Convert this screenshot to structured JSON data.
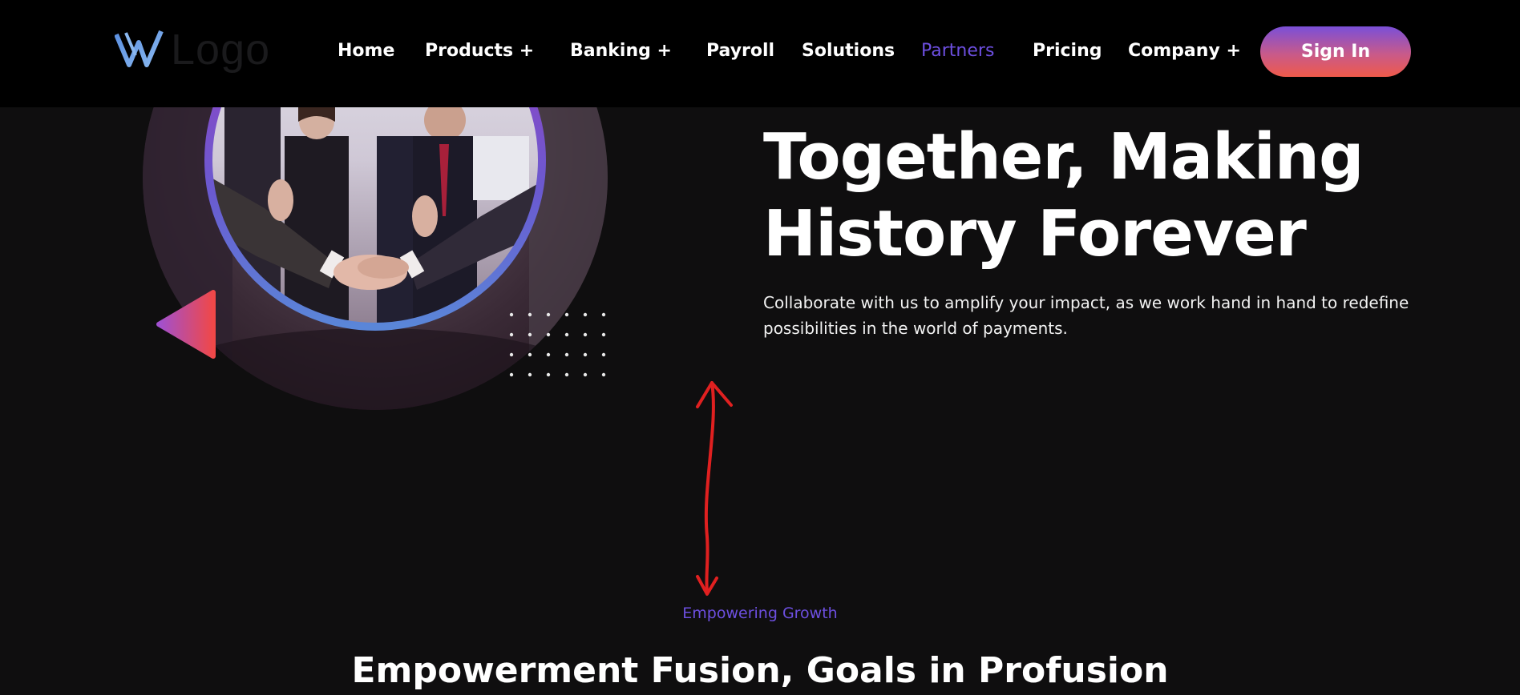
{
  "header": {
    "logo_text": "Logo",
    "nav": {
      "home": "Home",
      "products": "Products +",
      "banking": "Banking +",
      "payroll": "Payroll",
      "solutions": "Solutions",
      "partners": "Partners",
      "pricing": "Pricing",
      "company": "Company +"
    },
    "active_item": "Partners",
    "signin_label": "Sign In"
  },
  "hero": {
    "headline_line1": "Together, Making",
    "headline_line2": "History Forever",
    "intro": "Collaborate with us to amplify your impact, as we work hand in hand to redefine possibilities in the world of payments.",
    "image_subject": "business handshake"
  },
  "section": {
    "eyebrow": "Empowering Growth",
    "title": "Empowerment Fusion, Goals in Profusion"
  },
  "colors": {
    "background": "#0f0e0f",
    "header": "#000000",
    "accent": "#6d4fe0",
    "gradient_start": "#7a4fd8",
    "gradient_end": "#ef5a4a",
    "annotation": "#e02020"
  }
}
